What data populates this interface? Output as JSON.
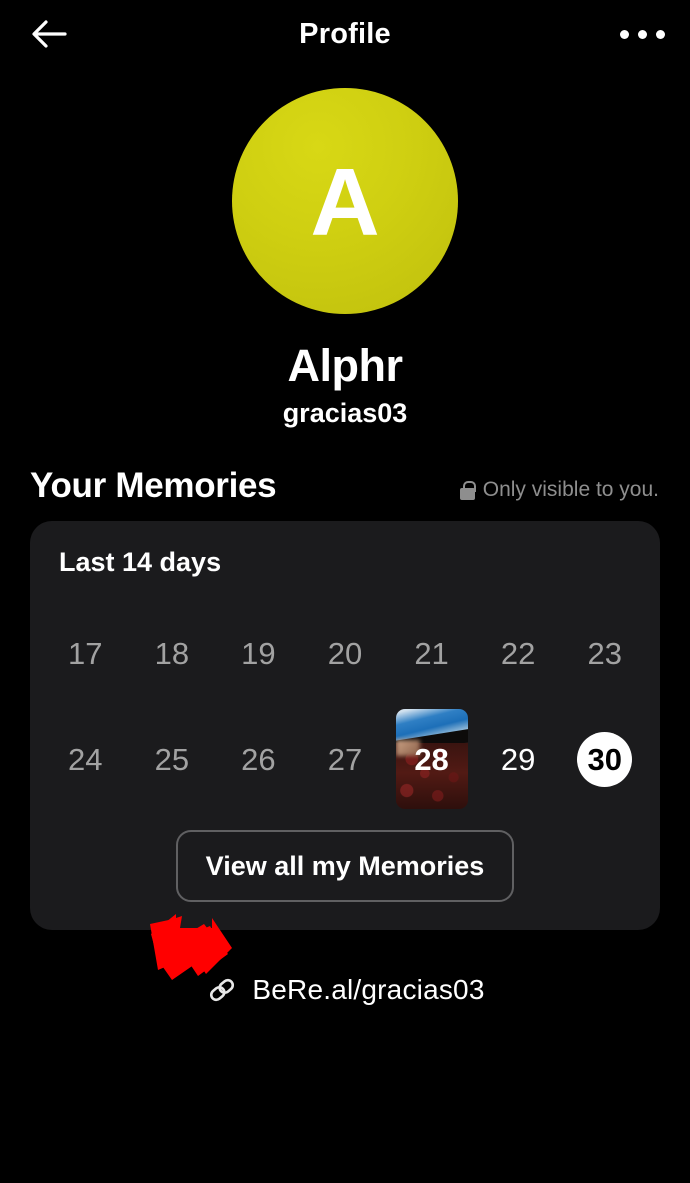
{
  "header": {
    "title": "Profile",
    "back_icon": "arrow-left-icon",
    "more_icon": "more-horizontal-icon"
  },
  "profile": {
    "avatar_letter": "A",
    "avatar_color": "#cfcf11",
    "display_name": "Alphr",
    "username": "gracias03"
  },
  "memories": {
    "title": "Your Memories",
    "visibility_icon": "lock-icon",
    "visibility_text": "Only visible to you.",
    "card_title": "Last 14 days",
    "rows": [
      [
        {
          "day": "17",
          "state": "empty"
        },
        {
          "day": "18",
          "state": "empty"
        },
        {
          "day": "19",
          "state": "empty"
        },
        {
          "day": "20",
          "state": "empty"
        },
        {
          "day": "21",
          "state": "empty"
        },
        {
          "day": "22",
          "state": "empty"
        },
        {
          "day": "23",
          "state": "empty"
        }
      ],
      [
        {
          "day": "24",
          "state": "empty"
        },
        {
          "day": "25",
          "state": "empty"
        },
        {
          "day": "26",
          "state": "empty"
        },
        {
          "day": "27",
          "state": "empty"
        },
        {
          "day": "28",
          "state": "has-memory"
        },
        {
          "day": "29",
          "state": "bright"
        },
        {
          "day": "30",
          "state": "today"
        }
      ]
    ],
    "view_all_label": "View all my Memories"
  },
  "annotation": {
    "arrow_color": "#ff0000",
    "arrow_direction": "down-right"
  },
  "profile_link": {
    "icon": "link-chain-icon",
    "text": "BeRe.al/gracias03"
  }
}
